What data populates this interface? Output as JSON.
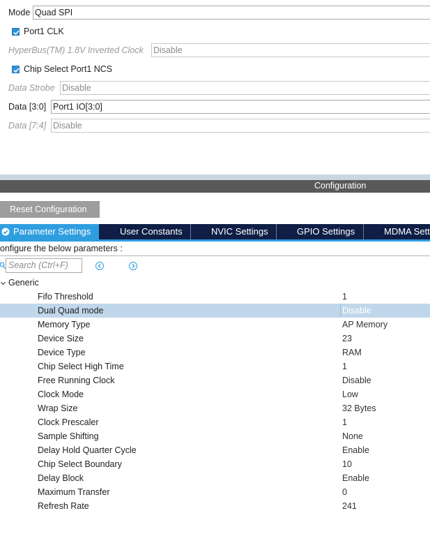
{
  "mode": {
    "label": "Mode",
    "value": "Quad SPI"
  },
  "port1_clk": {
    "label": "Port1 CLK",
    "checked": true
  },
  "hyperbus": {
    "label": "HyperBus(TM) 1.8V Inverted Clock",
    "value": "Disable"
  },
  "chip_select": {
    "label": "Chip Select Port1 NCS",
    "checked": true
  },
  "data_strobe": {
    "label": "Data Strobe",
    "value": "Disable"
  },
  "data_3_0": {
    "label": "Data [3:0]",
    "value": "Port1 IO[3:0]"
  },
  "data_7_4": {
    "label": "Data [7:4]",
    "value": "Disable"
  },
  "configuration": {
    "title": "Configuration"
  },
  "reset_button": {
    "label": "Reset Configuration"
  },
  "tabs": [
    {
      "label": "Parameter Settings",
      "active": true
    },
    {
      "label": "User Constants"
    },
    {
      "label": "NVIC Settings"
    },
    {
      "label": "GPIO Settings"
    },
    {
      "label": "MDMA Sett"
    }
  ],
  "hint": "onfigure the below parameters :",
  "search": {
    "placeholder": "Search (Ctrl+F)"
  },
  "group": {
    "label": "Generic"
  },
  "params": [
    {
      "name": "Fifo Threshold",
      "value": "1"
    },
    {
      "name": "Dual Quad mode",
      "value": "Disable",
      "selected": true
    },
    {
      "name": "Memory Type",
      "value": "AP Memory"
    },
    {
      "name": "Device Size",
      "value": "23"
    },
    {
      "name": "Device Type",
      "value": "RAM"
    },
    {
      "name": "Chip Select High Time",
      "value": "1"
    },
    {
      "name": "Free Running Clock",
      "value": "Disable"
    },
    {
      "name": "Clock Mode",
      "value": "Low"
    },
    {
      "name": "Wrap Size",
      "value": "32 Bytes"
    },
    {
      "name": "Clock Prescaler",
      "value": "1"
    },
    {
      "name": "Sample Shifting",
      "value": "None"
    },
    {
      "name": "Delay Hold Quarter Cycle",
      "value": "Enable"
    },
    {
      "name": "Chip Select Boundary",
      "value": "10"
    },
    {
      "name": "Delay Block",
      "value": "Enable"
    },
    {
      "name": "Maximum Transfer",
      "value": "0"
    },
    {
      "name": "Refresh Rate",
      "value": "241"
    }
  ]
}
